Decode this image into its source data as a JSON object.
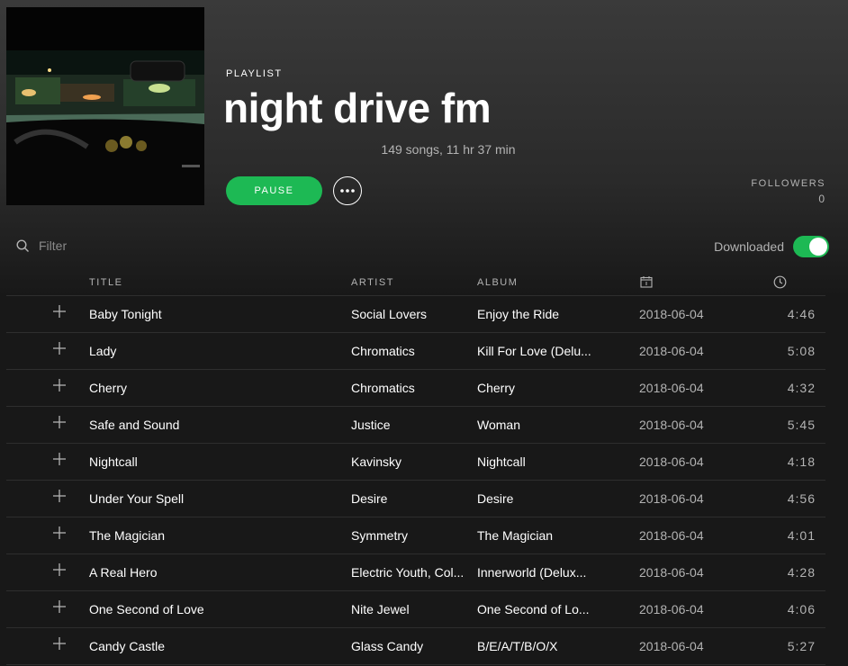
{
  "header": {
    "type_label": "PLAYLIST",
    "title": "night drive fm",
    "stats": "149 songs, 11 hr 37 min",
    "play_button_label": "PAUSE",
    "followers_label": "FOLLOWERS",
    "followers_count": "0"
  },
  "filter": {
    "placeholder": "Filter"
  },
  "downloaded": {
    "label": "Downloaded",
    "enabled": true
  },
  "colors": {
    "accent": "#1db954",
    "background": "#181818",
    "muted_text": "#b3b3b3"
  },
  "table": {
    "headers": {
      "title": "TITLE",
      "artist": "ARTIST",
      "album": "ALBUM",
      "date_icon": "calendar-icon",
      "duration_icon": "clock-icon"
    },
    "rows": [
      {
        "title": "Baby Tonight",
        "artist": "Social Lovers",
        "album": "Enjoy the Ride",
        "date": "2018-06-04",
        "duration": "4:46"
      },
      {
        "title": "Lady",
        "artist": "Chromatics",
        "album": "Kill For Love (Delu...",
        "date": "2018-06-04",
        "duration": "5:08"
      },
      {
        "title": "Cherry",
        "artist": "Chromatics",
        "album": "Cherry",
        "date": "2018-06-04",
        "duration": "4:32"
      },
      {
        "title": "Safe and Sound",
        "artist": "Justice",
        "album": "Woman",
        "date": "2018-06-04",
        "duration": "5:45"
      },
      {
        "title": "Nightcall",
        "artist": "Kavinsky",
        "album": "Nightcall",
        "date": "2018-06-04",
        "duration": "4:18"
      },
      {
        "title": "Under Your Spell",
        "artist": "Desire",
        "album": "Desire",
        "date": "2018-06-04",
        "duration": "4:56"
      },
      {
        "title": "The Magician",
        "artist": "Symmetry",
        "album": "The Magician",
        "date": "2018-06-04",
        "duration": "4:01"
      },
      {
        "title": "A Real Hero",
        "artist": "Electric Youth, Col...",
        "album": "Innerworld (Delux...",
        "date": "2018-06-04",
        "duration": "4:28"
      },
      {
        "title": "One Second of Love",
        "artist": "Nite Jewel",
        "album": "One Second of Lo...",
        "date": "2018-06-04",
        "duration": "4:06"
      },
      {
        "title": "Candy Castle",
        "artist": "Glass Candy",
        "album": "B/E/A/T/B/O/X",
        "date": "2018-06-04",
        "duration": "5:27"
      }
    ]
  }
}
